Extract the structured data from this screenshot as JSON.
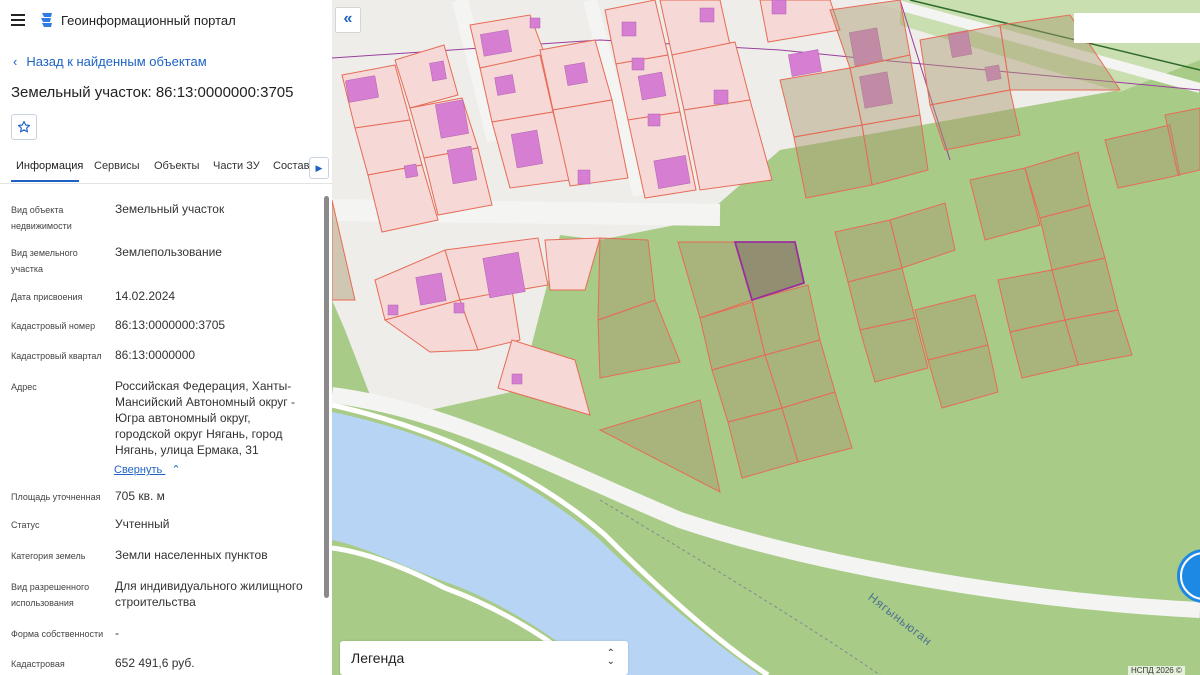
{
  "app": {
    "title": "Геоинформационный портал"
  },
  "panel": {
    "back_label": "Назад к найденным объектам",
    "object_title": "Земельный участок: 86:13:0000000:3705",
    "tabs": [
      "Информация",
      "Сервисы",
      "Объекты",
      "Части ЗУ",
      "Состав"
    ],
    "active_tab": "Информация",
    "collapse_label": "Свернуть",
    "properties": [
      {
        "label": "Вид объекта недвижимости",
        "value": "Земельный участок"
      },
      {
        "label": "Вид земельного участка",
        "value": "Землепользование"
      },
      {
        "label": "Дата присвоения",
        "value": "14.02.2024"
      },
      {
        "label": "Кадастровый номер",
        "value": "86:13:0000000:3705"
      },
      {
        "label": "Кадастровый квартал",
        "value": "86:13:0000000"
      },
      {
        "label": "Адрес",
        "value": "Российская Федерация, Ханты-Мансийский Автономный округ - Югра автономный округ, городской округ Нягань, город Нягань, улица Ермака, 31"
      },
      {
        "label": "Площадь уточненная",
        "value": "705 кв. м"
      },
      {
        "label": "Статус",
        "value": "Учтенный"
      },
      {
        "label": "Категория земель",
        "value": "Земли населенных пунктов"
      },
      {
        "label": "Вид разрешенного использования",
        "value": "Для индивидуального жилищного строительства"
      },
      {
        "label": "Форма собственности",
        "value": "-"
      },
      {
        "label": "Кадастровая",
        "value": "652 491,6 руб."
      }
    ]
  },
  "map": {
    "legend_label": "Легенда",
    "river_label": "Нягыньюган",
    "copyright": "НСПД 2026 ©",
    "colors": {
      "vegetation": "#a8cb87",
      "built_area": "#eeedea",
      "parcel_fill": "#f6d8d6",
      "parcel_stroke": "#e76b57",
      "building": "#d67fd2",
      "river": "#b7d4f4",
      "selected_parcel": "#8a7a6b",
      "accent": "#1e63c4"
    }
  }
}
